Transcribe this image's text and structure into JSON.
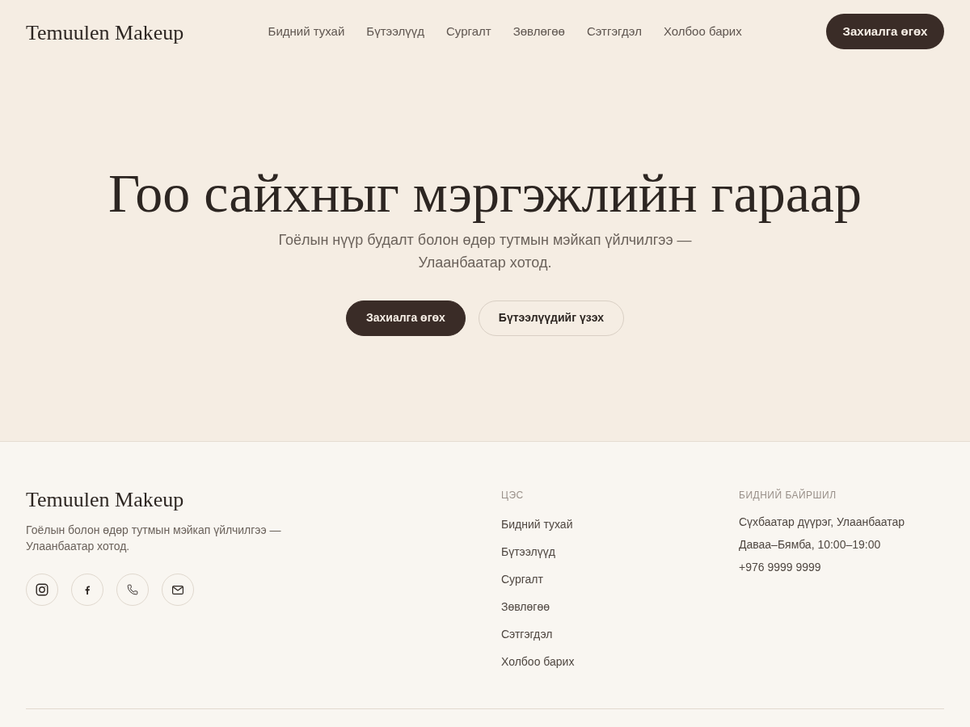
{
  "header": {
    "logo": "Temuulen Makeup",
    "nav": [
      "Бидний тухай",
      "Бүтээлүүд",
      "Сургалт",
      "Зөвлөгөө",
      "Сэтгэгдэл",
      "Холбоо барих"
    ],
    "cta": "Захиалга өгөх"
  },
  "hero": {
    "title": "Гоо сайхныг мэргэжлийн гараар",
    "subtitle": "Гоёлын нүүр будалт болон өдөр тутмын мэйкап үйлчилгээ — Улаанбаатар хотод.",
    "buttons": [
      {
        "label": "Захиалга өгөх",
        "kind": "primary"
      },
      {
        "label": "Бүтээлүүдийг үзэх",
        "kind": "outline"
      }
    ]
  },
  "footer": {
    "brand": "Temuulen Makeup",
    "description": "Гоёлын болон өдөр тутмын мэйкап үйлчилгээ — Улаанбаатар хотод.",
    "menu": {
      "heading": "ЦЭС",
      "links": [
        "Бидний тухай",
        "Бүтээлүүд",
        "Сургалт",
        "Зөвлөгөө",
        "Сэтгэгдэл",
        "Холбоо барих"
      ]
    },
    "location": {
      "heading": "БИДНИЙ БАЙРШИЛ",
      "lines": [
        "Сүхбаатар дүүрэг, Улаанбаатар",
        "Даваа–Бямба, 10:00–19:00",
        "+976 9999 9999"
      ]
    }
  }
}
